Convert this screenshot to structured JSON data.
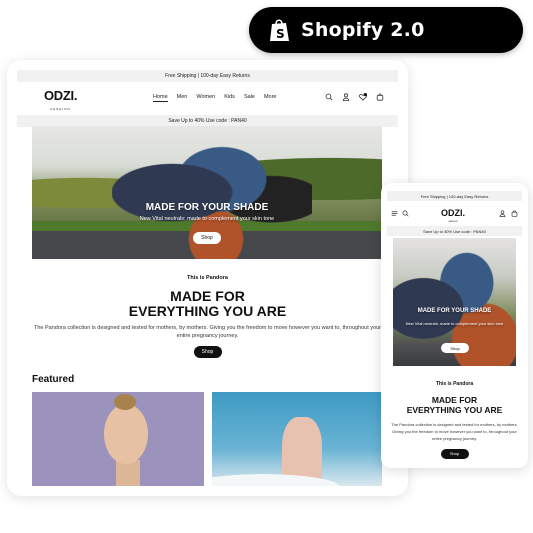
{
  "badge": {
    "label": "Shopify 2.0",
    "icon": "shopify-bag-icon"
  },
  "desktop": {
    "announcement_top": "Free Shipping | 100-day Easy Returns",
    "logo": {
      "name": "ODZI.",
      "tagline": "FASHION"
    },
    "menu": [
      {
        "label": "Home",
        "active": true
      },
      {
        "label": "Men"
      },
      {
        "label": "Women"
      },
      {
        "label": "Kids"
      },
      {
        "label": "Sale"
      },
      {
        "label": "More"
      }
    ],
    "header_icons": [
      "search-icon",
      "account-icon",
      "wishlist-icon",
      "cart-icon"
    ],
    "wishlist_count": "0",
    "announcement_promo": "Save Up to 40% Use code : PAN40",
    "hero": {
      "title": "MADE FOR YOUR SHADE",
      "subtitle": "New Vital neutrals: made to complement your skin tone",
      "button": "Shop"
    },
    "intro": {
      "eyebrow": "This is Pandora",
      "title_line1": "MADE FOR",
      "title_line2": "EVERYTHING YOU ARE",
      "body": "The Pandora collection is designed and tested for mothers, by mothers. Giving you the freedom to move however you want to, throughout your entire pregnancy journey.",
      "button": "Shop"
    },
    "featured": {
      "heading": "Featured"
    }
  },
  "mobile": {
    "announcement_top": "Free Shipping | 100-day Easy Returns",
    "logo": {
      "name": "ODZI.",
      "tagline": "FASHION"
    },
    "announcement_promo": "Save Up to 40% Use code : PAN40",
    "hero": {
      "title": "MADE FOR YOUR SHADE",
      "subtitle": "New Vital neutrals: made to complement your skin tone",
      "button": "Shop"
    },
    "intro": {
      "eyebrow": "This is Pandora",
      "title_line1": "MADE FOR",
      "title_line2": "EVERYTHING YOU ARE",
      "body": "The Pandora collection is designed and tested for mothers, by mothers. Giving you the freedom to move however you want to, throughout your entire pregnancy journey.",
      "button": "Shop"
    }
  }
}
